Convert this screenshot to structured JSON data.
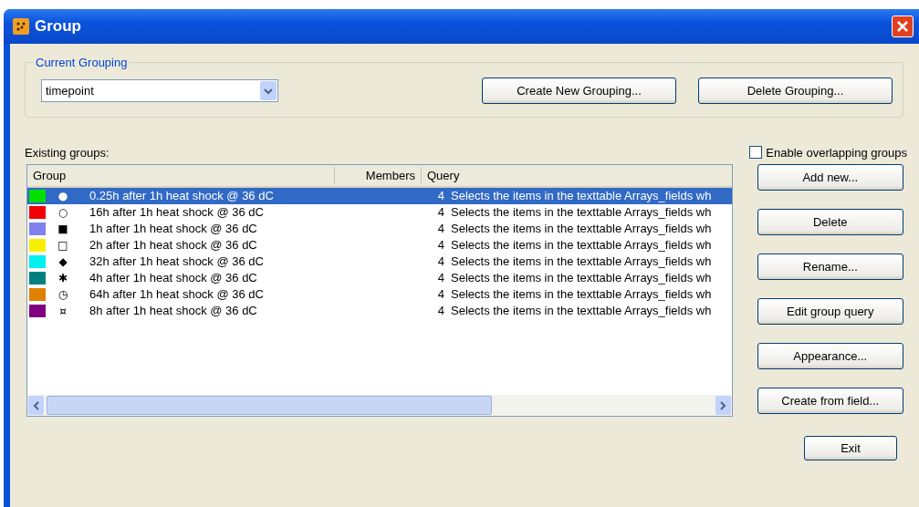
{
  "window": {
    "title": "Group"
  },
  "current_grouping": {
    "label": "Current Grouping",
    "value": "timepoint",
    "buttons": [
      "Create New Grouping...",
      "Delete Grouping..."
    ]
  },
  "existing_label": "Existing groups:",
  "overlap": {
    "label": "Enable overlapping groups",
    "checked": false
  },
  "table": {
    "columns": [
      "Group",
      "Members",
      "Query"
    ],
    "rows": [
      {
        "color": "#00e000",
        "symbol": "●",
        "name": "0.25h after 1h heat shock @ 36 dC",
        "members": "4",
        "query": "Selects the items in the texttable Arrays_fields wh",
        "selected": true
      },
      {
        "color": "#f00000",
        "symbol": "○",
        "name": "16h after 1h heat shock @ 36 dC",
        "members": "4",
        "query": "Selects the items in the texttable Arrays_fields wh",
        "selected": false
      },
      {
        "color": "#8080f0",
        "symbol": "■",
        "name": "1h after 1h heat shock @ 36 dC",
        "members": "4",
        "query": "Selects the items in the texttable Arrays_fields wh",
        "selected": false
      },
      {
        "color": "#f8f000",
        "symbol": "□",
        "name": "2h after 1h heat shock @ 36 dC",
        "members": "4",
        "query": "Selects the items in the texttable Arrays_fields wh",
        "selected": false
      },
      {
        "color": "#00f0f0",
        "symbol": "◆",
        "name": "32h after 1h heat shock @ 36 dC",
        "members": "4",
        "query": "Selects the items in the texttable Arrays_fields wh",
        "selected": false
      },
      {
        "color": "#008080",
        "symbol": "✱",
        "name": "4h after 1h heat shock @ 36 dC",
        "members": "4",
        "query": "Selects the items in the texttable Arrays_fields wh",
        "selected": false
      },
      {
        "color": "#e08000",
        "symbol": "◷",
        "name": "64h after 1h heat shock @ 36 dC",
        "members": "4",
        "query": "Selects the items in the texttable Arrays_fields wh",
        "selected": false
      },
      {
        "color": "#800080",
        "symbol": "¤",
        "name": "8h after 1h heat shock @ 36 dC",
        "members": "4",
        "query": "Selects the items in the texttable Arrays_fields wh",
        "selected": false
      }
    ]
  },
  "side_buttons": [
    "Add new...",
    "Delete",
    "Rename...",
    "Edit group query",
    "Appearance...",
    "Create from field..."
  ],
  "exit_button": "Exit"
}
